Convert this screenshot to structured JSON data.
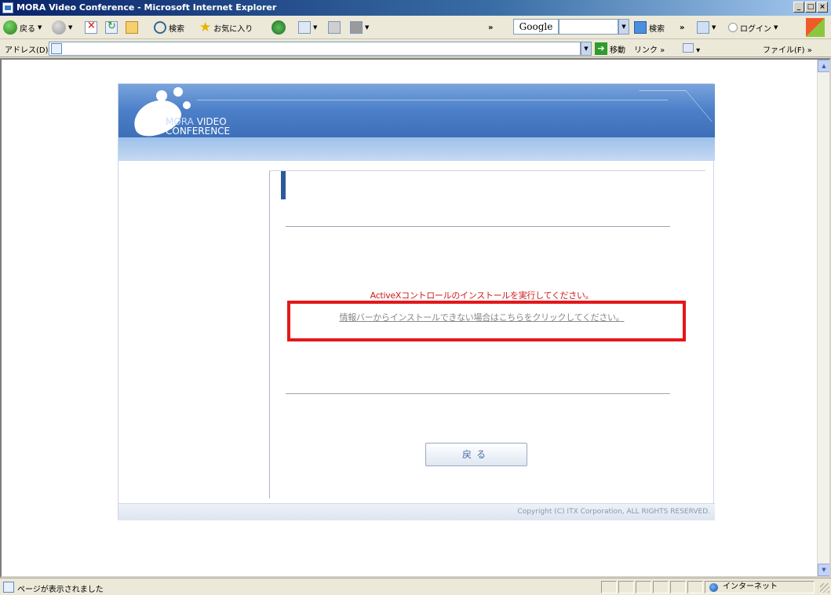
{
  "window": {
    "title": "MORA Video Conference - Microsoft Internet Explorer",
    "controls": [
      "_",
      "□",
      "×"
    ]
  },
  "toolbar": {
    "back_label": "戻る",
    "search_label": "検索",
    "favorites_label": "お気に入り",
    "google_label": "Google",
    "google_search_label": "検索",
    "login_label": "ログイン"
  },
  "address": {
    "label": "アドレス(D)",
    "value": "",
    "go_label": "移動",
    "links_label": "リンク",
    "file_label": "ファイル(F)"
  },
  "page": {
    "logo_line1_a": "MORA",
    "logo_line1_b": "VIDEO",
    "logo_line2": "CONFERENCE",
    "message_main": "ActiveXコントロールのインストールを実行してください。",
    "message_link": "情報バーからインストールできない場合はこちらをクリックしてください。",
    "back_button": "戻る",
    "copyright": "Copyright (C) ITX Corporation, ALL RIGHTS RESERVED."
  },
  "status": {
    "text": "ページが表示されました",
    "zone": "インターネット"
  },
  "colors": {
    "banner_blue": "#4b7fc8",
    "message_red": "#d01818",
    "highlight_red": "#e4171b"
  }
}
